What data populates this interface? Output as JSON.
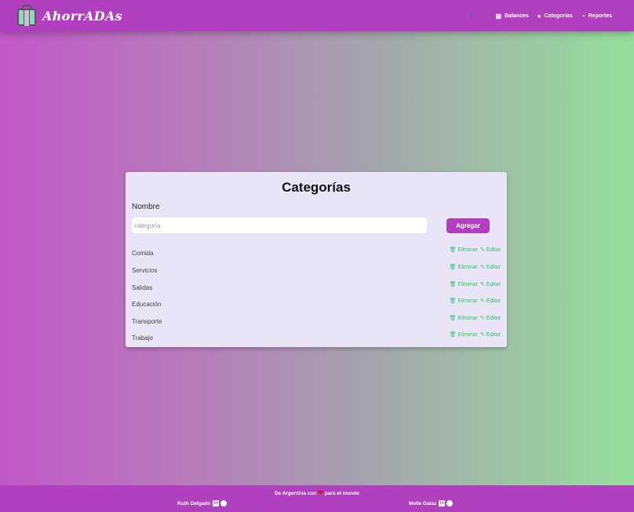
{
  "app": {
    "name": "AhorrADAs"
  },
  "nav": {
    "theme_icon": "moon-icon",
    "items": [
      {
        "label": "Balances",
        "icon": "chart-icon"
      },
      {
        "label": "Categorias",
        "icon": "tag-icon"
      },
      {
        "label": "Reportes",
        "icon": "pie-chart-icon"
      }
    ]
  },
  "categories_panel": {
    "title": "Categorías",
    "name_label": "Nombre",
    "input": {
      "placeholder": "categoría",
      "value": ""
    },
    "add_button": "Agregar",
    "delete_label": "Eliminar",
    "edit_label": "Editar",
    "items": [
      "Comida",
      "Servicios",
      "Salidas",
      "Educación",
      "Transporte",
      "Trabajo"
    ]
  },
  "footer": {
    "prefix": "De Argentina con",
    "suffix": "para el mundo",
    "authors": [
      "Ruth Delgado",
      "Melle Galaz"
    ]
  },
  "colors": {
    "primary": "#b040bd",
    "action_green": "#2fc46a",
    "card_bg": "#e9e4f6"
  }
}
